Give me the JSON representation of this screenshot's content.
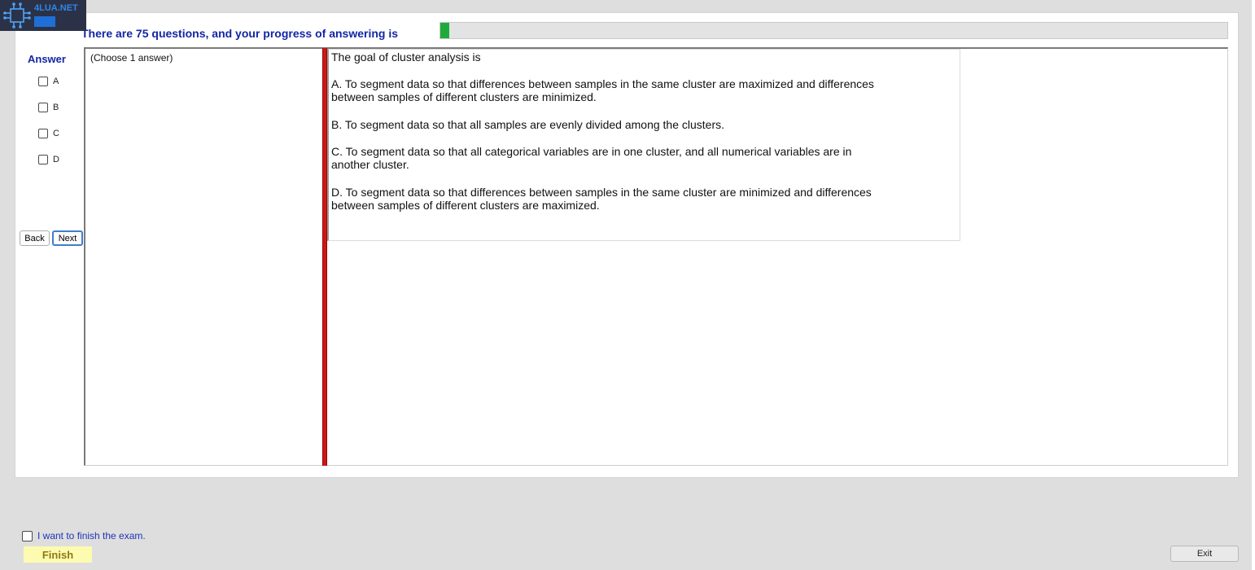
{
  "logo": {
    "text": "4LUA.NET",
    "badge": ""
  },
  "header": {
    "progress_text": "There are 75 questions, and your progress of answering is",
    "progress_value": 0.011
  },
  "answer": {
    "title": "Answer",
    "options": [
      "A",
      "B",
      "C",
      "D"
    ]
  },
  "navigation": {
    "back_label": "Back",
    "next_label": "Next"
  },
  "instruction": "(Choose 1 answer)",
  "question": {
    "stem": "The goal of cluster analysis is",
    "choices": [
      {
        "line1": "A.  To segment data so that differences between samples in the same cluster are maximized and differences",
        "line2": "between samples of different clusters are minimized."
      },
      {
        "line1": "B.  To segment data so that all samples are evenly divided among the clusters.",
        "line2": ""
      },
      {
        "line1": "C.  To segment data so that all categorical variables are in one cluster, and all numerical variables are in",
        "line2": "another cluster."
      },
      {
        "line1": "D.  To segment data so that differences between samples in the same cluster are minimized and differences",
        "line2": "between samples of different clusters are maximized."
      }
    ]
  },
  "footer": {
    "finish_check_label": "I want to finish the exam.",
    "finish_label": "Finish",
    "exit_label": "Exit"
  },
  "colors": {
    "title_blue": "#1226a6",
    "progress_green": "#1fab3a",
    "splitter_red": "#d41414",
    "finish_yellow": "#fdfbb0"
  }
}
